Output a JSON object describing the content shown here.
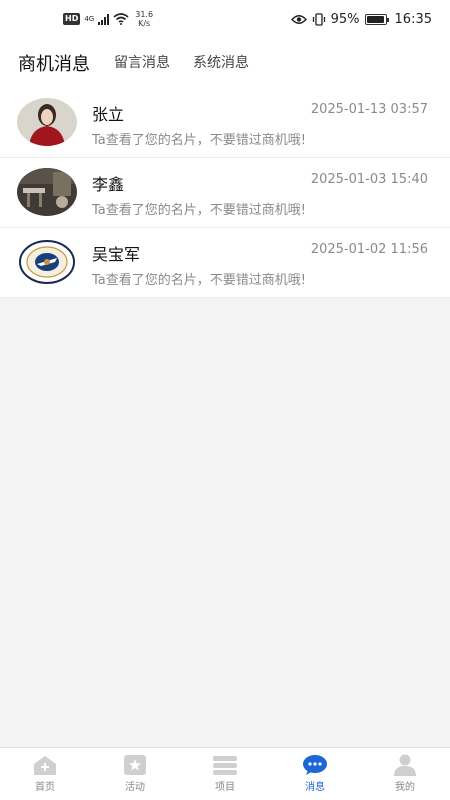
{
  "status_bar": {
    "hd": "HD",
    "network_type": "4G",
    "net_speed": "31.6",
    "net_unit": "K/s",
    "battery_level": "95%",
    "battery_fraction": 0.95,
    "time": "16:35"
  },
  "header": {
    "tabs": [
      {
        "label": "商机消息",
        "active": true
      },
      {
        "label": "留言消息",
        "active": false
      },
      {
        "label": "系统消息",
        "active": false
      }
    ]
  },
  "messages": [
    {
      "name": "张立",
      "time": "2025-01-13 03:57",
      "text": "Ta查看了您的名片，不要错过商机哦!",
      "avatar": "photo-woman-red-avatar"
    },
    {
      "name": "李鑫",
      "time": "2025-01-03 15:40",
      "text": "Ta查看了您的名片，不要错过商机哦!",
      "avatar": "photo-interior-avatar"
    },
    {
      "name": "吴宝军",
      "time": "2025-01-02 11:56",
      "text": "Ta查看了您的名片，不要错过商机哦!",
      "avatar": "emblem-logo-avatar"
    }
  ],
  "tabbar": {
    "accent": "#1d66d8",
    "items": [
      {
        "label": "首页",
        "icon": "home-icon",
        "active": false
      },
      {
        "label": "活动",
        "icon": "activity-icon",
        "active": false
      },
      {
        "label": "项目",
        "icon": "project-icon",
        "active": false
      },
      {
        "label": "消息",
        "icon": "message-icon",
        "active": true
      },
      {
        "label": "我的",
        "icon": "profile-icon",
        "active": false
      }
    ]
  }
}
